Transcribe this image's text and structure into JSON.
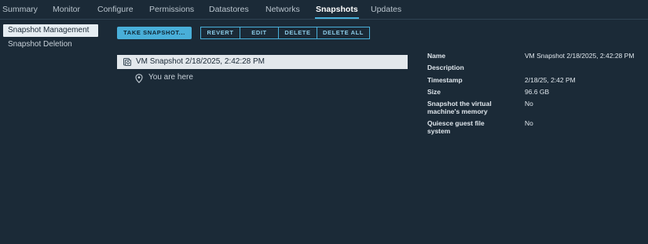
{
  "tabs": [
    "Summary",
    "Monitor",
    "Configure",
    "Permissions",
    "Datastores",
    "Networks",
    "Snapshots",
    "Updates"
  ],
  "active_tab": "Snapshots",
  "sidebar": {
    "items": [
      {
        "label": "Snapshot Management",
        "active": true
      },
      {
        "label": "Snapshot Deletion",
        "active": false
      }
    ]
  },
  "toolbar": {
    "take_snapshot": "TAKE SNAPSHOT...",
    "revert": "REVERT",
    "edit": "EDIT",
    "delete": "DELETE",
    "delete_all": "DELETE ALL"
  },
  "tree": {
    "snapshot_label": "VM Snapshot 2/18/2025, 2:42:28 PM",
    "snapshot_icon": "snapshot-icon",
    "you_are_here": "You are here",
    "location_icon": "location-pin-icon"
  },
  "details": {
    "name_label": "Name",
    "name_value": "VM Snapshot 2/18/2025, 2:42:28 PM",
    "description_label": "Description",
    "description_value": "",
    "timestamp_label": "Timestamp",
    "timestamp_value": "2/18/25, 2:42 PM",
    "size_label": "Size",
    "size_value": "96.6 GB",
    "memory_label": "Snapshot the virtual machine's memory",
    "memory_value": "No",
    "quiesce_label": "Quiesce guest file system",
    "quiesce_value": "No"
  },
  "colors": {
    "background": "#1b2a37",
    "accent": "#49afd9",
    "selected_row": "#e3e8ec"
  }
}
